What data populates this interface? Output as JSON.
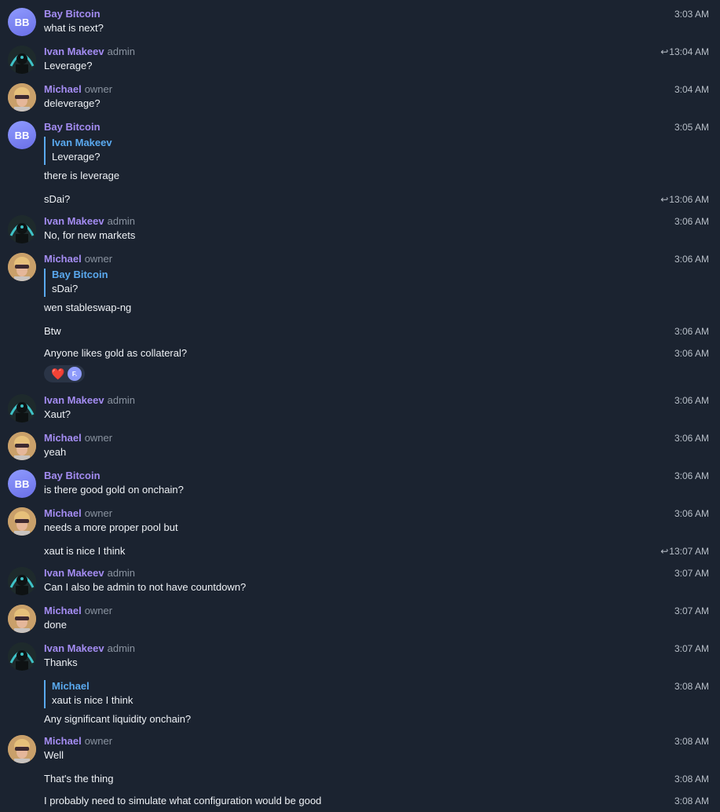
{
  "messages": [
    {
      "sender": "Bay Bitcoin",
      "role": "",
      "avatar": "BB",
      "text": "what is next?",
      "time": "3:03 AM"
    },
    {
      "sender": "Ivan Makeev",
      "role": "admin",
      "text": "Leverage?",
      "time": "3:04 AM",
      "reply_count": "1"
    },
    {
      "sender": "Michael",
      "role": "owner",
      "text": "deleverage?",
      "time": "3:04 AM"
    },
    {
      "sender": "Bay Bitcoin",
      "role": "",
      "avatar": "BB",
      "quote_name": "Ivan Makeev",
      "quote_text": "Leverage?",
      "text": "there is leverage",
      "time": "3:05 AM"
    },
    {
      "text": "sDai?",
      "time": "3:06 AM",
      "reply_count": "1"
    },
    {
      "sender": "Ivan Makeev",
      "role": "admin",
      "text": "No, for new markets",
      "time": "3:06 AM"
    },
    {
      "sender": "Michael",
      "role": "owner",
      "quote_name": "Bay Bitcoin",
      "quote_text": "sDai?",
      "text": "wen stableswap-ng",
      "time": "3:06 AM"
    },
    {
      "text": "Btw",
      "time": "3:06 AM"
    },
    {
      "text": "Anyone likes gold as collateral?",
      "time": "3:06 AM",
      "reaction": "❤️",
      "reactor": "F."
    },
    {
      "sender": "Ivan Makeev",
      "role": "admin",
      "text": "Xaut?",
      "time": "3:06 AM"
    },
    {
      "sender": "Michael",
      "role": "owner",
      "text": "yeah",
      "time": "3:06 AM"
    },
    {
      "sender": "Bay Bitcoin",
      "role": "",
      "avatar": "BB",
      "text": "is there good gold on onchain?",
      "time": "3:06 AM"
    },
    {
      "sender": "Michael",
      "role": "owner",
      "text": "needs a more proper pool but",
      "time": "3:06 AM"
    },
    {
      "text": "xaut is nice I think",
      "time": "3:07 AM",
      "reply_count": "1"
    },
    {
      "sender": "Ivan Makeev",
      "role": "admin",
      "text": "Can I also be admin to not have countdown?",
      "time": "3:07 AM"
    },
    {
      "sender": "Michael",
      "role": "owner",
      "text": "done",
      "time": "3:07 AM"
    },
    {
      "sender": "Ivan Makeev",
      "role": "admin",
      "text": "Thanks",
      "time": "3:07 AM"
    },
    {
      "quote_name": "Michael",
      "quote_text": "xaut is nice I think",
      "text": "Any significant liquidity onchain?",
      "time": "3:08 AM"
    },
    {
      "sender": "Michael",
      "role": "owner",
      "text": "Well",
      "time": "3:08 AM"
    },
    {
      "text": "That's the thing",
      "time": "3:08 AM"
    },
    {
      "text": "I probably need to simulate what configuration would be good",
      "time": "3:08 AM"
    }
  ],
  "icons": {
    "reply": "reply-arrow-icon",
    "reaction": "heart-icon"
  },
  "colors": {
    "background": "#1b2330",
    "sender_name": "#a48cf2",
    "quote_accent": "#5aa9ef",
    "role": "#8a93a0",
    "time": "#b8bfc8"
  }
}
